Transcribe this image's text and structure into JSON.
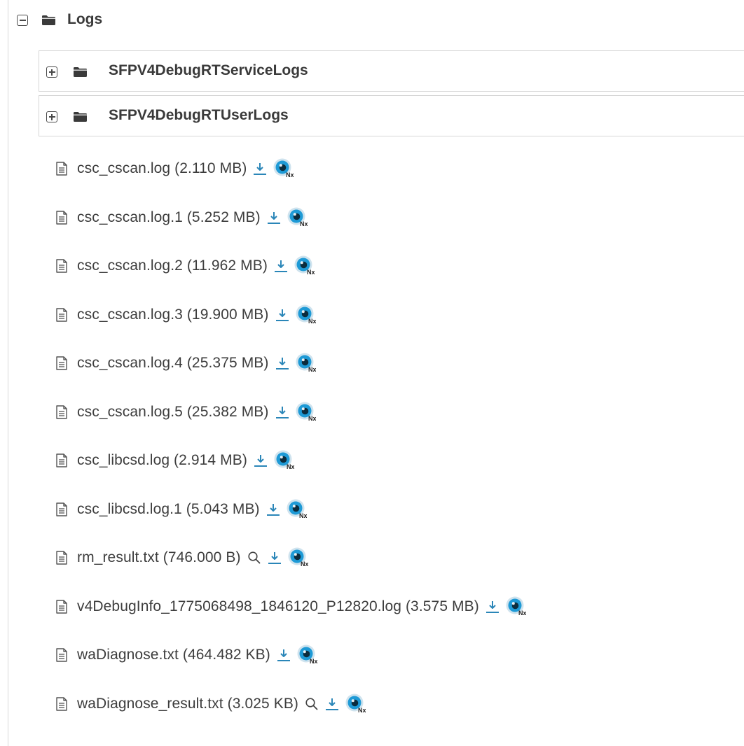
{
  "root_folder": {
    "label": "Logs",
    "toggle": "collapse-icon",
    "icon": "folder-icon"
  },
  "subfolders": [
    {
      "label": "SFPV4DebugRTServiceLogs",
      "toggle": "expand-icon",
      "icon": "folder-icon"
    },
    {
      "label": "SFPV4DebugRTUserLogs",
      "toggle": "expand-icon",
      "icon": "folder-icon"
    }
  ],
  "files": [
    {
      "label": "csc_cscan.log (2.110 MB)",
      "preview": false
    },
    {
      "label": "csc_cscan.log.1 (5.252 MB)",
      "preview": false
    },
    {
      "label": "csc_cscan.log.2 (11.962 MB)",
      "preview": false
    },
    {
      "label": "csc_cscan.log.3 (19.900 MB)",
      "preview": false
    },
    {
      "label": "csc_cscan.log.4 (25.375 MB)",
      "preview": false
    },
    {
      "label": "csc_cscan.log.5 (25.382 MB)",
      "preview": false
    },
    {
      "label": "csc_libcsd.log (2.914 MB)",
      "preview": false
    },
    {
      "label": "csc_libcsd.log.1 (5.043 MB)",
      "preview": false
    },
    {
      "label": "rm_result.txt (746.000 B)",
      "preview": true
    },
    {
      "label": "v4DebugInfo_1775068498_1846120_P12820.log (3.575 MB)",
      "preview": false
    },
    {
      "label": "waDiagnose.txt (464.482 KB)",
      "preview": false
    },
    {
      "label": "waDiagnose_result.txt (3.025 KB)",
      "preview": true
    }
  ],
  "icons": {
    "file": "file-text-icon",
    "preview": "search-icon",
    "download": "download-icon",
    "viewer": "nx-viewer-icon"
  },
  "colors": {
    "accent": "#2a86b8",
    "viewer_eye": "#1e9ad6",
    "viewer_ring": "#cfe3ee",
    "text": "#3d3d3d",
    "border": "#d6d6d6"
  }
}
